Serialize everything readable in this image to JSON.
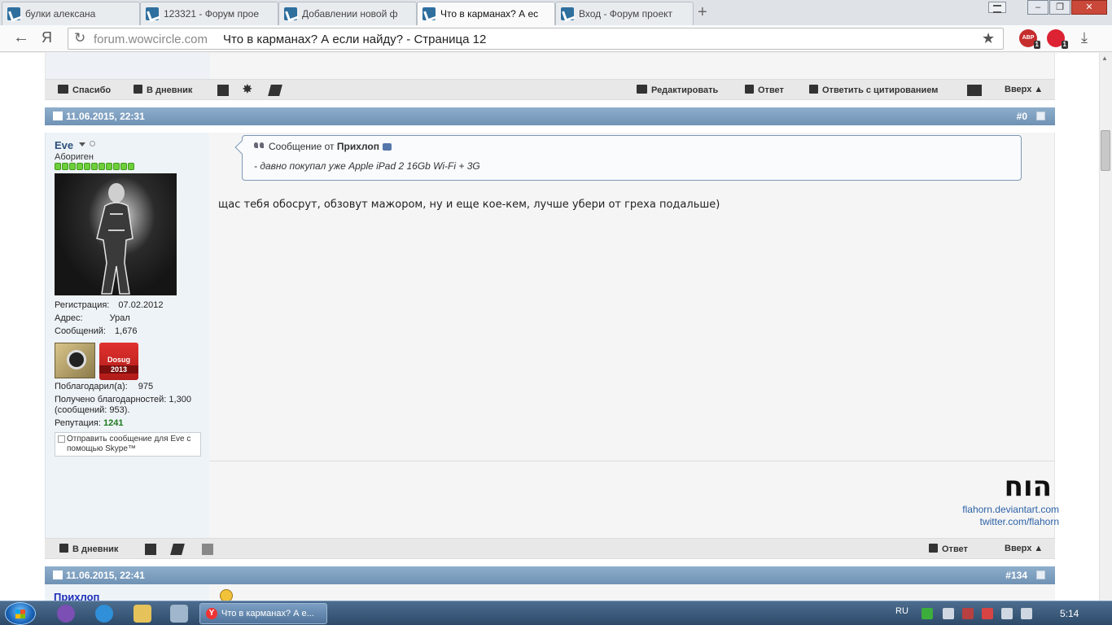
{
  "browser": {
    "tabs": [
      {
        "label": "булки алексана"
      },
      {
        "label": "123321 - Форум прое"
      },
      {
        "label": "Добавлении новой ф"
      },
      {
        "label": "Что в карманах? А ес"
      },
      {
        "label": "Вход - Форум проект"
      }
    ],
    "active_tab": 3,
    "new_tab_label": "+",
    "yandex_label": "Я",
    "url_domain": "forum.wowcircle.com",
    "url_title": "Что в карманах? А если найду? - Страница 12",
    "ext_abp_label": "ABP",
    "ext_abp_badge": "1",
    "ext_other_badge": "1"
  },
  "prev_post_actions": {
    "thanks_label": "Спасибо",
    "diary_label": "В дневник",
    "edit_label": "Редактировать",
    "reply_label": "Ответ",
    "quote_reply_label": "Ответить с цитированием",
    "top_label": "Вверх ▲"
  },
  "post": {
    "date": "11.06.2015, 22:31",
    "number": "#0",
    "user": {
      "name": "Eve",
      "title": "Абориген",
      "registration_label": "Регистрация:",
      "registration_value": "07.02.2012",
      "address_label": "Адрес:",
      "address_value": "Урал",
      "messages_label": "Сообщений:",
      "messages_value": "1,676",
      "award_label_line1": "Dosug",
      "award_label_line2": "2013",
      "thanked_label": "Поблагодарил(а):",
      "thanked_value": "975",
      "received_line1": "Получено благодарностей: 1,300",
      "received_line2": "(сообщений: 953).",
      "reputation_label": "Репутация:",
      "reputation_value": "1241",
      "skype_text": "Отправить сообщение для Eve с помощью Skype™"
    },
    "quote": {
      "prefix": "Сообщение от",
      "author": "Прихлоп",
      "text": "- давно покупал уже Apple iPad 2 16Gb Wi-Fi + 3G"
    },
    "message": "щас тебя обосрут, обзовут мажором, ну и еще кое-кем, лучше убери от греха подальше)",
    "signature": {
      "logo": "הוח",
      "link1": "flahorn.deviantart.com",
      "link2": "twitter.com/flahorn"
    },
    "actions": {
      "diary_label": "В дневник",
      "reply_label": "Ответ",
      "top_label": "Вверх ▲"
    }
  },
  "next_post": {
    "date": "11.06.2015, 22:41",
    "number": "#134",
    "user_name": "Прихлоп"
  },
  "taskbar": {
    "task_label": "Что в карманах? А е...",
    "lang": "RU",
    "time": "5:14"
  }
}
